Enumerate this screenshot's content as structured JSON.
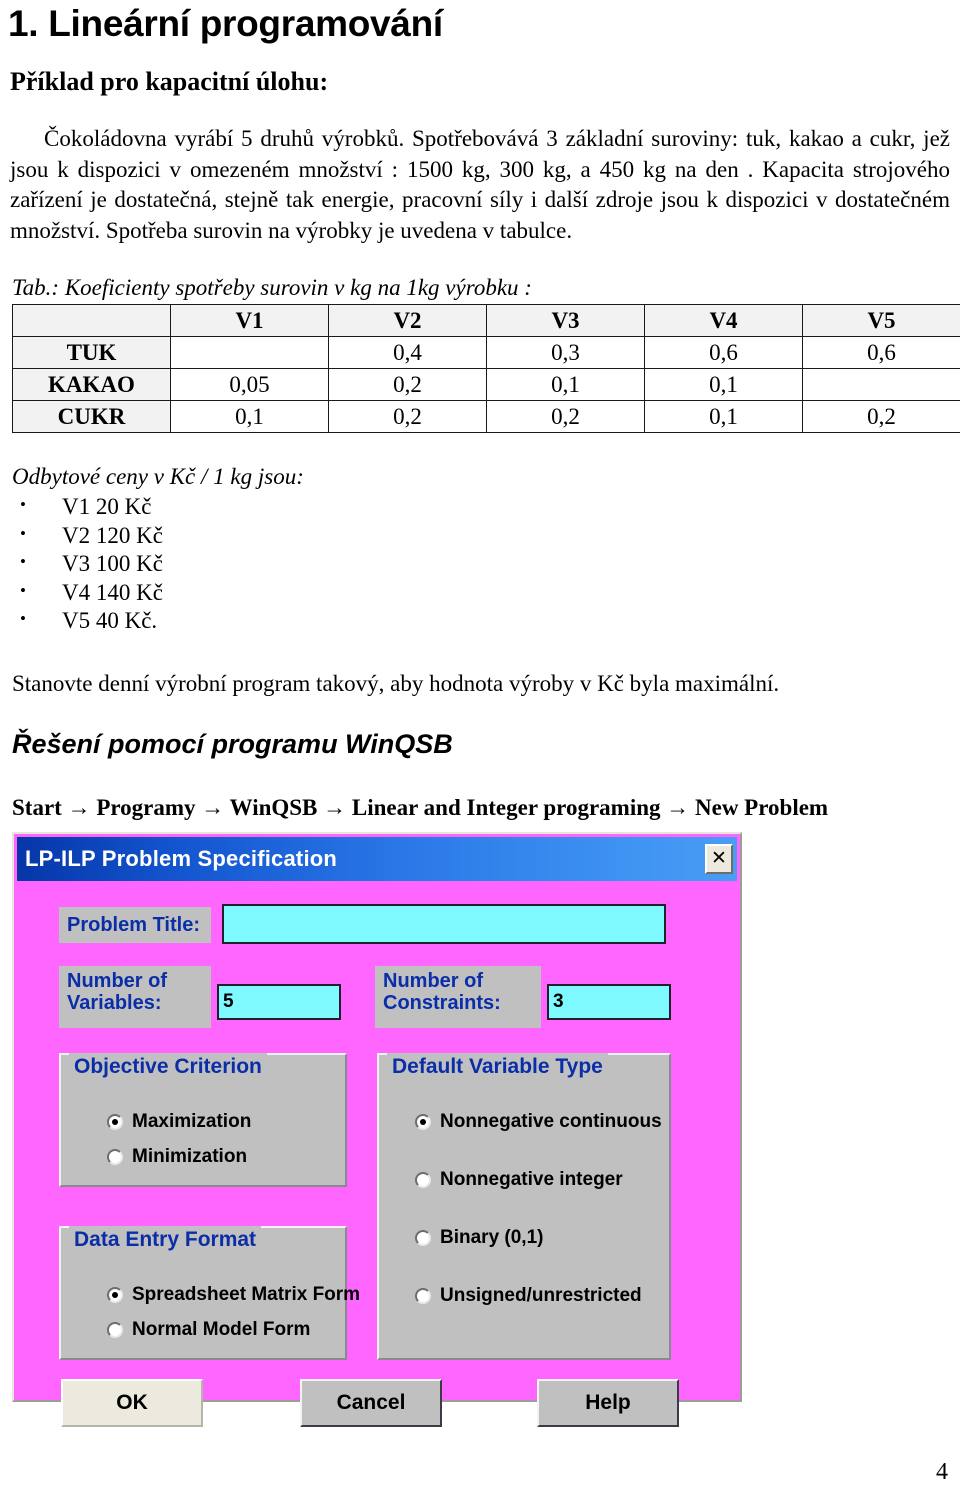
{
  "document": {
    "title": "1. Lineární programování",
    "subtitle": "Příklad pro kapacitní úlohu:",
    "paragraph": "Čokoládovna vyrábí 5 druhů výrobků. Spotřebovává 3 základní suroviny: tuk, kakao a cukr, jež jsou k dispozici v omezeném množství : 1500 kg, 300 kg, a 450 kg na den . Kapacita strojového zařízení je dostatečná, stejně tak energie, pracovní síly i další zdroje jsou k dispozici v dostatečném množství.  Spotřeba surovin na výrobky je uvedena  v tabulce.",
    "table_caption": "Tab.: Koeficienty spotřeby surovin  v kg na 1kg  výrobku :",
    "price_intro": "Odbytové ceny v Kč / 1 kg  jsou:",
    "prices": [
      "V1 20 Kč",
      "V2 120 Kč",
      "V3 100 Kč",
      "V4 140 Kč",
      "V5 40 Kč."
    ],
    "closing_paragraph": "Stanovte denní výrobní program  takový, aby  hodnota výroby v Kč byla maximální.",
    "solution_heading": "Řešení pomocí programu WinQSB",
    "nav_path": "Start → Programy → WinQSB → Linear and Integer programing → New Problem",
    "page_number": "4"
  },
  "coef_table": {
    "columns": [
      "",
      "V1",
      "V2",
      "V3",
      "V4",
      "V5"
    ],
    "rows": [
      {
        "label": "TUK",
        "values": [
          "",
          "0,4",
          "0,3",
          "0,6",
          "0,6"
        ]
      },
      {
        "label": "KAKAO",
        "values": [
          "0,05",
          "0,2",
          "0,1",
          "0,1",
          ""
        ]
      },
      {
        "label": "CUKR",
        "values": [
          "0,1",
          "0,2",
          "0,2",
          "0,1",
          "0,2"
        ]
      }
    ]
  },
  "dialog": {
    "title": "LP-ILP Problem Specification",
    "close_label": "✕",
    "problem_title": {
      "label": "Problem Title:",
      "value": "",
      "placeholder": ""
    },
    "number_of_variables": {
      "label_line1": "Number of",
      "label_line2": "Variables:",
      "value": "5"
    },
    "number_of_constraints": {
      "label_line1": "Number of",
      "label_line2": "Constraints:",
      "value": "3"
    },
    "objective_criterion": {
      "legend": "Objective Criterion",
      "options": [
        {
          "label": "Maximization",
          "selected": true
        },
        {
          "label": "Minimization",
          "selected": false
        }
      ]
    },
    "data_entry_format": {
      "legend": "Data Entry Format",
      "options": [
        {
          "label": "Spreadsheet Matrix Form",
          "selected": true
        },
        {
          "label": "Normal Model Form",
          "selected": false
        }
      ]
    },
    "default_variable_type": {
      "legend": "Default Variable Type",
      "options": [
        {
          "label": "Nonnegative continuous",
          "selected": true
        },
        {
          "label": "Nonnegative integer",
          "selected": false
        },
        {
          "label": "Binary (0,1)",
          "selected": false
        },
        {
          "label": "Unsigned/unrestricted",
          "selected": false
        }
      ]
    },
    "buttons": {
      "ok": "OK",
      "cancel": "Cancel",
      "help": "Help"
    },
    "colors": {
      "dialog_background": "#ff66ff",
      "titlebar_start": "#0636a8",
      "titlebar_end": "#4a9cf4",
      "control_gray": "#c0c0c0",
      "textbox_cyan": "#7df9ff",
      "legend_blue": "#0b2ea8",
      "ok_button": "#eceade"
    }
  }
}
